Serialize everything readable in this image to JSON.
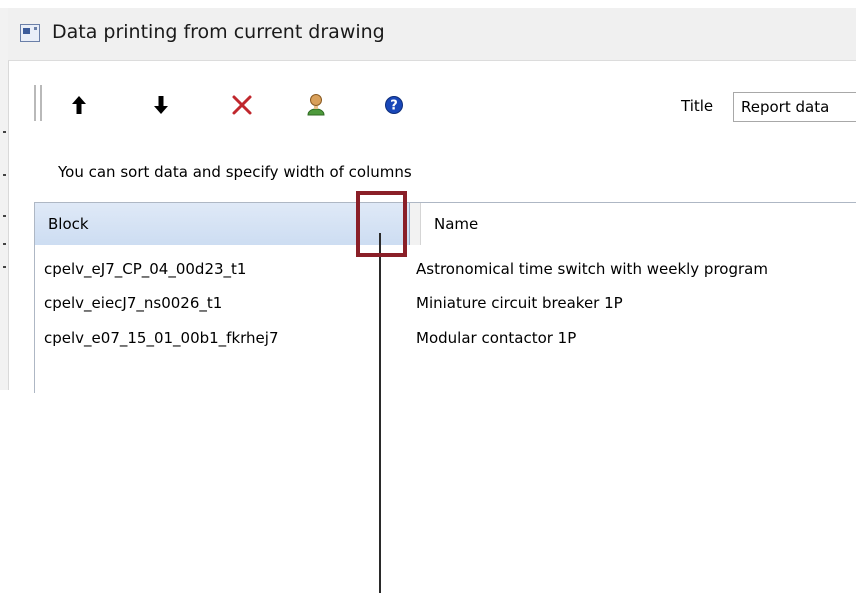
{
  "window": {
    "title": "Data printing from current drawing"
  },
  "toolbar": {
    "items": [
      {
        "name": "move-up-button",
        "icon": "arrow-up-icon"
      },
      {
        "name": "move-down-button",
        "icon": "arrow-down-icon"
      },
      {
        "name": "delete-button",
        "icon": "red-x-icon"
      },
      {
        "name": "user-button",
        "icon": "user-icon"
      },
      {
        "name": "help-button",
        "icon": "help-icon"
      }
    ],
    "title_label": "Title",
    "title_value": "Report data"
  },
  "hint": "You can sort data and specify width of columns",
  "table": {
    "columns": [
      "Block",
      "Name"
    ],
    "rows": [
      {
        "block": "cpelv_eJ7_CP_04_00d23_t1",
        "name": "Astronomical time switch with weekly program"
      },
      {
        "block": "cpelv_eiecJ7_ns0026_t1",
        "name": "Miniature circuit breaker 1P"
      },
      {
        "block": "cpelv_e07_15_01_00b1_fkrhej7",
        "name": "Modular contactor 1P"
      }
    ]
  },
  "colors": {
    "header_selected": "#cdddf2",
    "highlight": "#8a1f28",
    "delete_icon": "#c0272d",
    "help_icon": "#1947b8"
  }
}
